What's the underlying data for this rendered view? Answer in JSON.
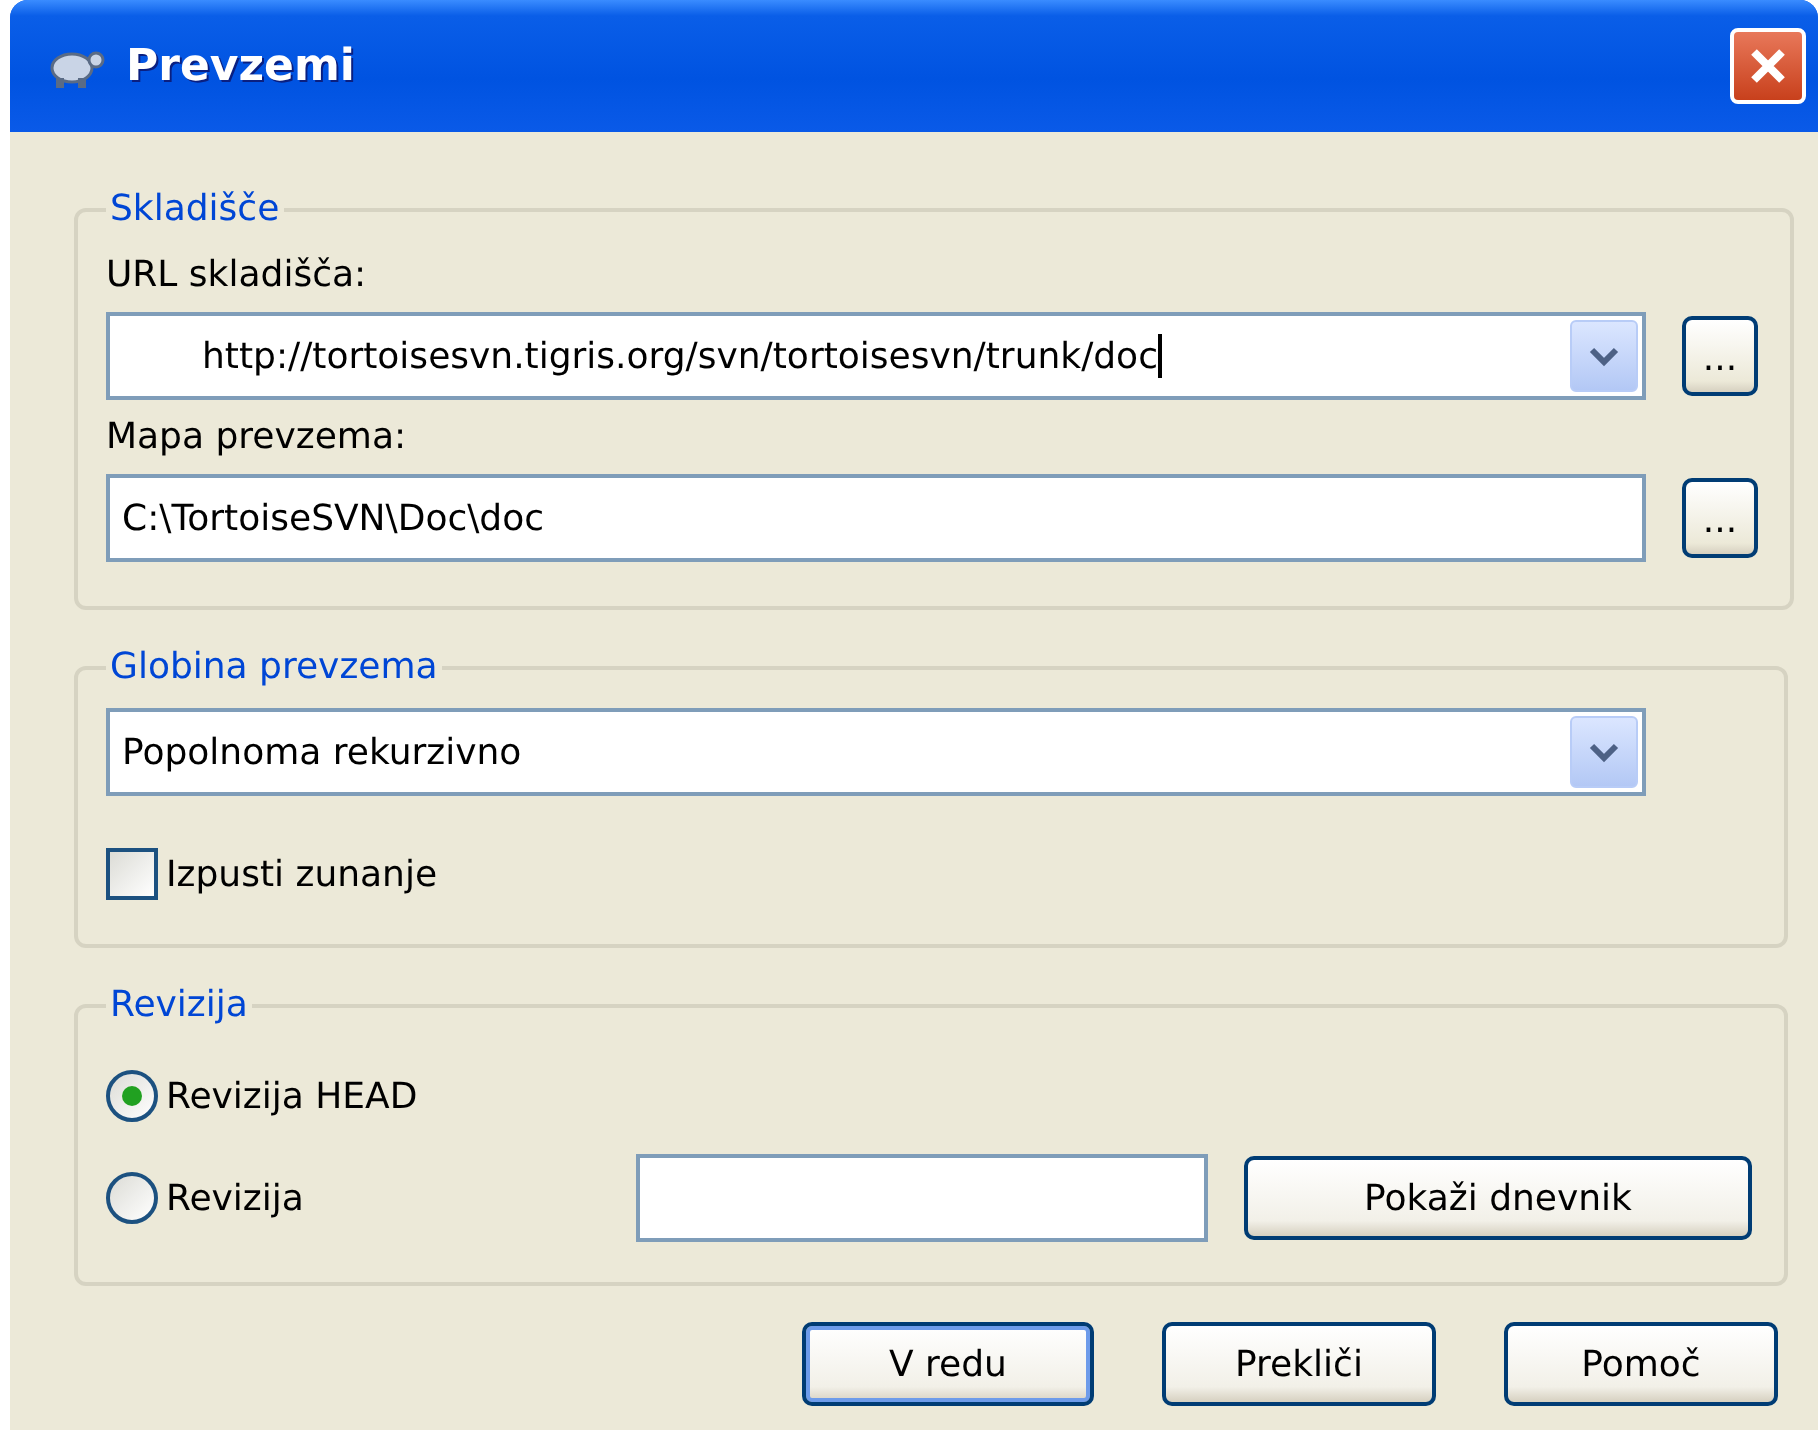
{
  "window": {
    "title": "Prevzemi"
  },
  "repository": {
    "legend": "Skladišče",
    "url_label": "URL skladišča:",
    "url_value": "http://tortoisesvn.tigris.org/svn/tortoisesvn/trunk/doc",
    "folder_label": "Mapa prevzema:",
    "folder_value": "C:\\TortoiseSVN\\Doc\\doc",
    "browse_buttons": [
      "...",
      "..."
    ]
  },
  "depth": {
    "legend": "Globina prevzema",
    "value": "Popolnoma rekurzivno",
    "omit_externals": {
      "label": "Izpusti zunanje",
      "checked": false
    }
  },
  "revision": {
    "legend": "Revizija",
    "options": [
      {
        "label": "Revizija HEAD",
        "selected": true
      },
      {
        "label": "Revizija",
        "selected": false
      }
    ],
    "show_log": "Pokaži dnevnik"
  },
  "buttons": [
    {
      "label": "V redu",
      "default": true
    },
    {
      "label": "Prekliči",
      "default": false
    },
    {
      "label": "Pomoč",
      "default": false
    }
  ]
}
